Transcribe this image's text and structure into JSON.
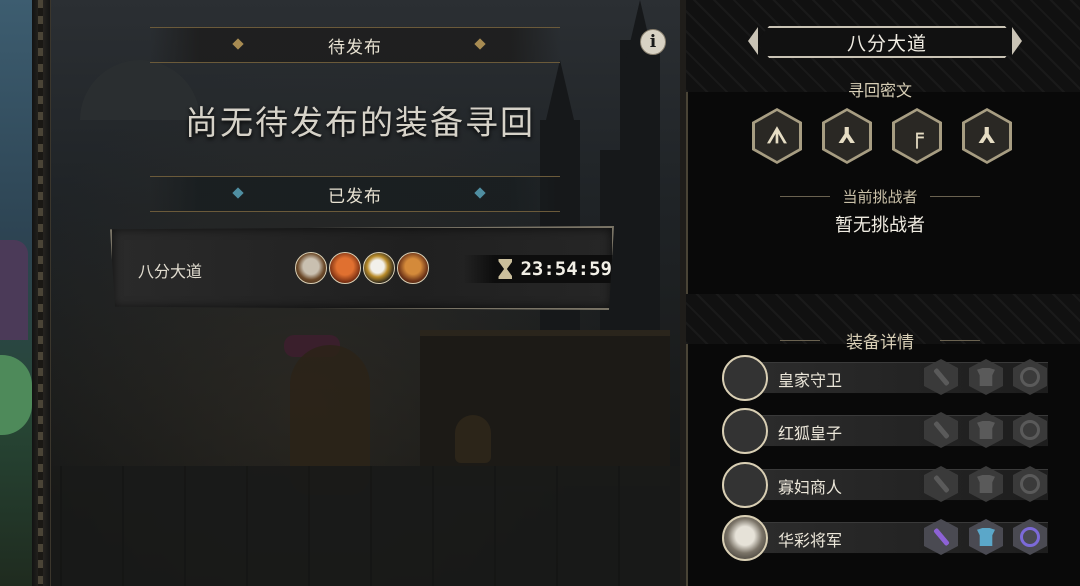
{
  "header": {
    "pending_label": "待发布",
    "empty_message": "尚无待发布的装备寻回",
    "published_label": "已发布",
    "info_glyph": "i"
  },
  "published_entry": {
    "name": "八分大道",
    "timer": "23:54:59",
    "members": [
      "royal-guard-portrait",
      "red-fox-prince-portrait",
      "widow-merchant-portrait",
      "fox-portrait"
    ]
  },
  "panel": {
    "title": "八分大道",
    "cipher_label": "寻回密文",
    "runes": [
      "ᗑ",
      "⅄",
      "╒",
      "⅄"
    ],
    "challenger_label": "当前挑战者",
    "challenger_value": "暂无挑战者",
    "equipment_label": "装备详情",
    "equipment": [
      {
        "name": "皇家守卫",
        "slots": {
          "weapon": false,
          "armor": false,
          "ring": false
        }
      },
      {
        "name": "红狐皇子",
        "slots": {
          "weapon": false,
          "armor": false,
          "ring": false
        }
      },
      {
        "name": "寡妇商人",
        "slots": {
          "weapon": false,
          "armor": false,
          "ring": false
        }
      },
      {
        "name": "华彩将军",
        "slots": {
          "weapon": true,
          "armor": true,
          "ring": true
        }
      }
    ]
  },
  "colors": {
    "accent_gold": "#a88b52",
    "accent_teal": "#4f8ea1",
    "entry_glow": "#3cbec8",
    "weapon_active": "#8d62d6",
    "armor_active": "#5ba7c9",
    "ring_active": "#7c6ad8"
  }
}
